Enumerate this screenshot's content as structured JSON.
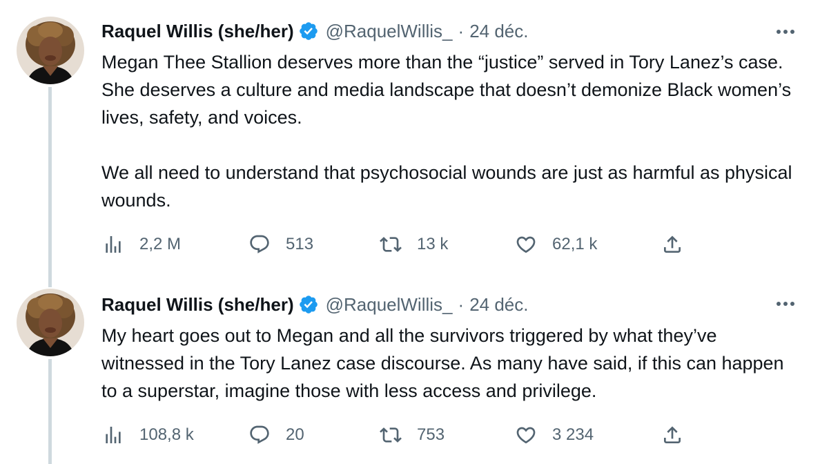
{
  "tweets": [
    {
      "author": {
        "display_name": "Raquel Willis (she/her)",
        "verified": true,
        "handle": "@RaquelWillis_",
        "separator": "·",
        "date": "24 déc."
      },
      "text": [
        "Megan Thee Stallion deserves more than the “justice” served in Tory Lanez’s case. She deserves a culture and media landscape that doesn’t demonize Black women’s lives, safety, and voices.",
        "We all need to understand that psychosocial wounds are just as harmful as physical wounds."
      ],
      "stats": {
        "views": "2,2 M",
        "replies": "513",
        "retweets": "13 k",
        "likes": "62,1 k"
      }
    },
    {
      "author": {
        "display_name": "Raquel Willis (she/her)",
        "verified": true,
        "handle": "@RaquelWillis_",
        "separator": "·",
        "date": "24 déc."
      },
      "text": [
        "My heart goes out to Megan and all the survivors triggered by what they’ve witnessed in the Tory Lanez case discourse. As many have said, if this can happen to a superstar, imagine those with less access and privilege."
      ],
      "stats": {
        "views": "108,8 k",
        "replies": "20",
        "retweets": "753",
        "likes": "3 234"
      }
    }
  ],
  "icons": {
    "views": "bar-chart-icon",
    "reply": "speech-bubble-icon",
    "retweet": "retweet-arrows-icon",
    "like": "heart-icon",
    "share": "share-upload-icon",
    "more": "more-dots-icon",
    "verified": "verified-badge-icon"
  },
  "colors": {
    "verified": "#1d9bf0",
    "muted_text": "#536471",
    "thread_line": "#cfd9de"
  }
}
